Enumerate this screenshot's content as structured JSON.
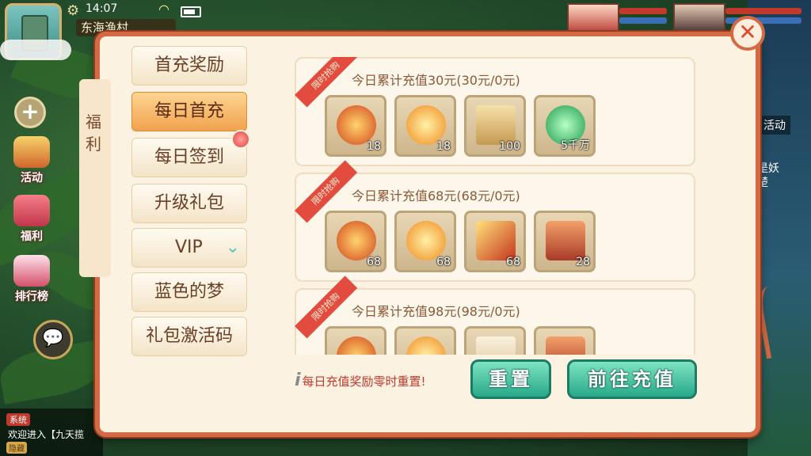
{
  "hud": {
    "time": "14:07",
    "location": "东海渔村"
  },
  "left_menu_icons": [
    {
      "label": "活动"
    },
    {
      "label": "福利"
    },
    {
      "label": "排行榜"
    }
  ],
  "chat": {
    "system_tag": "系统",
    "message": "欢迎进入【九天揽",
    "bottom_tag": "隐藏"
  },
  "right_hud": {
    "activity_label": "活动",
    "quest_text_line1": "是妖",
    "quest_text_line2": "楚"
  },
  "panel": {
    "side_title": "福利",
    "close_symbol": "✕",
    "tabs": [
      {
        "label": "首充奖励",
        "active": false
      },
      {
        "label": "每日首充",
        "active": true
      },
      {
        "label": "每日签到",
        "active": false,
        "has_badge": true
      },
      {
        "label": "升级礼包",
        "active": false
      },
      {
        "label": "VIP",
        "active": false,
        "expandable": true
      },
      {
        "label": "蓝色的梦",
        "active": false
      },
      {
        "label": "礼包激活码",
        "active": false
      }
    ],
    "rewards": [
      {
        "ribbon": "限时抢购",
        "title": "今日累计充值30元(30元/0元)",
        "items": [
          {
            "icon": "gift-medallion-icon",
            "count": "18"
          },
          {
            "icon": "fire-orb-icon",
            "count": "18"
          },
          {
            "icon": "scroll-ticket-icon",
            "count": "100"
          },
          {
            "icon": "jade-pendant-icon",
            "count": "5千万"
          }
        ]
      },
      {
        "ribbon": "限时抢购",
        "title": "今日累计充值68元(68元/0元)",
        "items": [
          {
            "icon": "gift-medallion-icon",
            "count": "68"
          },
          {
            "icon": "fire-orb-icon",
            "count": "68"
          },
          {
            "icon": "golden-scepter-icon",
            "count": "68"
          },
          {
            "icon": "treasure-chest-icon",
            "count": "28"
          }
        ]
      },
      {
        "ribbon": "限时抢购",
        "title": "今日累计充值98元(98元/0元)",
        "items": [
          {
            "icon": "gift-medallion-icon",
            "count": ""
          },
          {
            "icon": "fire-orb-icon",
            "count": ""
          },
          {
            "icon": "scroll-icon",
            "count": ""
          },
          {
            "icon": "treasure-chest-icon",
            "count": ""
          }
        ]
      }
    ],
    "footer_note": "每日充值奖励零时重置!",
    "reset_button": "重置",
    "recharge_button": "前往充值"
  },
  "colors": {
    "panel_border": "#d46a44",
    "active_tab": "#f0a24d",
    "button_teal": "#27a98a",
    "ribbon_red": "#e44b3f"
  }
}
